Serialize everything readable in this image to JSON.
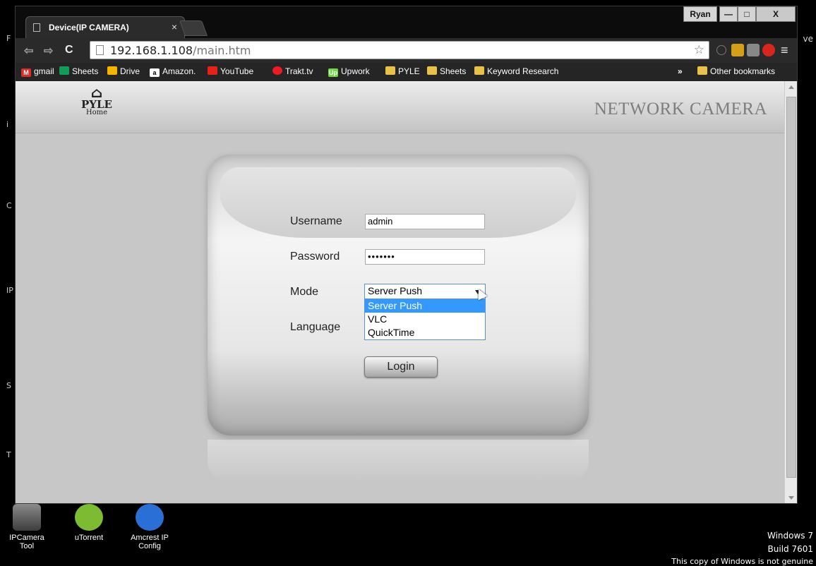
{
  "browser": {
    "tab_title": "Device(IP CAMERA)",
    "tab_close": "×",
    "user": "Ryan",
    "minimize_label": "—",
    "maximize_label": "□",
    "close_label": "X",
    "url_host": "192.168.1.108",
    "url_path": "/main.htm",
    "menu_glyph": "≡",
    "bookmarks": [
      "gmail",
      "Sheets",
      "Drive",
      "Amazon.",
      "YouTube",
      "Trakt.tv",
      "Upwork",
      "PYLE",
      "Sheets",
      "Keyword Research"
    ],
    "overflow": "»",
    "other_bookmarks": "Other bookmarks"
  },
  "page": {
    "logo_brand": "PYLE",
    "logo_sub": "Home",
    "header_title": "NETWORK CAMERA",
    "username_label": "Username",
    "username_value": "admin",
    "password_label": "Password",
    "password_value": "•••••••",
    "mode_label": "Mode",
    "mode_selected": "Server Push",
    "mode_options": [
      "Server Push",
      "VLC",
      "QuickTime"
    ],
    "language_label": "Language",
    "login_button": "Login"
  },
  "desktop": {
    "icons": [
      "IPCamera Tool",
      "uTorrent",
      "Amcrest IP Config"
    ],
    "notice_line1": "Windows 7",
    "notice_line2": "Build 7601",
    "notice_line3": "This copy of Windows is not genuine",
    "right_fragment": "ve"
  },
  "colors": {
    "selection": "#3399ff",
    "page_bg": "#c7c7c7"
  }
}
